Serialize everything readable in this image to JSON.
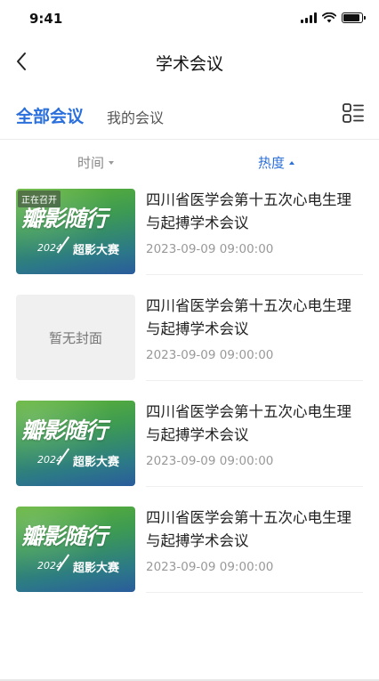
{
  "status_bar": {
    "time": "9:41",
    "battery_level": 0.9
  },
  "nav": {
    "title": "学术会议",
    "back_icon": "chevron-left-icon"
  },
  "tabs": {
    "all": "全部会议",
    "mine": "我的会议",
    "layout_icon": "list-layout-icon"
  },
  "sort": {
    "time_label": "时间",
    "hot_label": "热度"
  },
  "meetings": [
    {
      "title": "四川省医学会第十五次心电生理与起搏学术会议",
      "time": "2023-09-09 09:00:00",
      "badge": "正在召开",
      "cover": {
        "calligraphy": "瓣影随行",
        "year": "2024",
        "subtitle": "超影大赛"
      }
    },
    {
      "title": "四川省医学会第十五次心电生理与起搏学术会议",
      "time": "2023-09-09 09:00:00",
      "cover_placeholder": "暂无封面"
    },
    {
      "title": "四川省医学会第十五次心电生理与起搏学术会议",
      "time": "2023-09-09 09:00:00",
      "cover": {
        "calligraphy": "瓣影随行",
        "year": "2024",
        "subtitle": "超影大赛"
      }
    },
    {
      "title": "四川省医学会第十五次心电生理与起搏学术会议",
      "time": "2023-09-09 09:00:00",
      "cover": {
        "calligraphy": "瓣影随行",
        "year": "2024",
        "subtitle": "超影大赛"
      }
    }
  ],
  "colors": {
    "accent": "#2a6fdb",
    "text": "#222222",
    "muted": "#999999"
  }
}
